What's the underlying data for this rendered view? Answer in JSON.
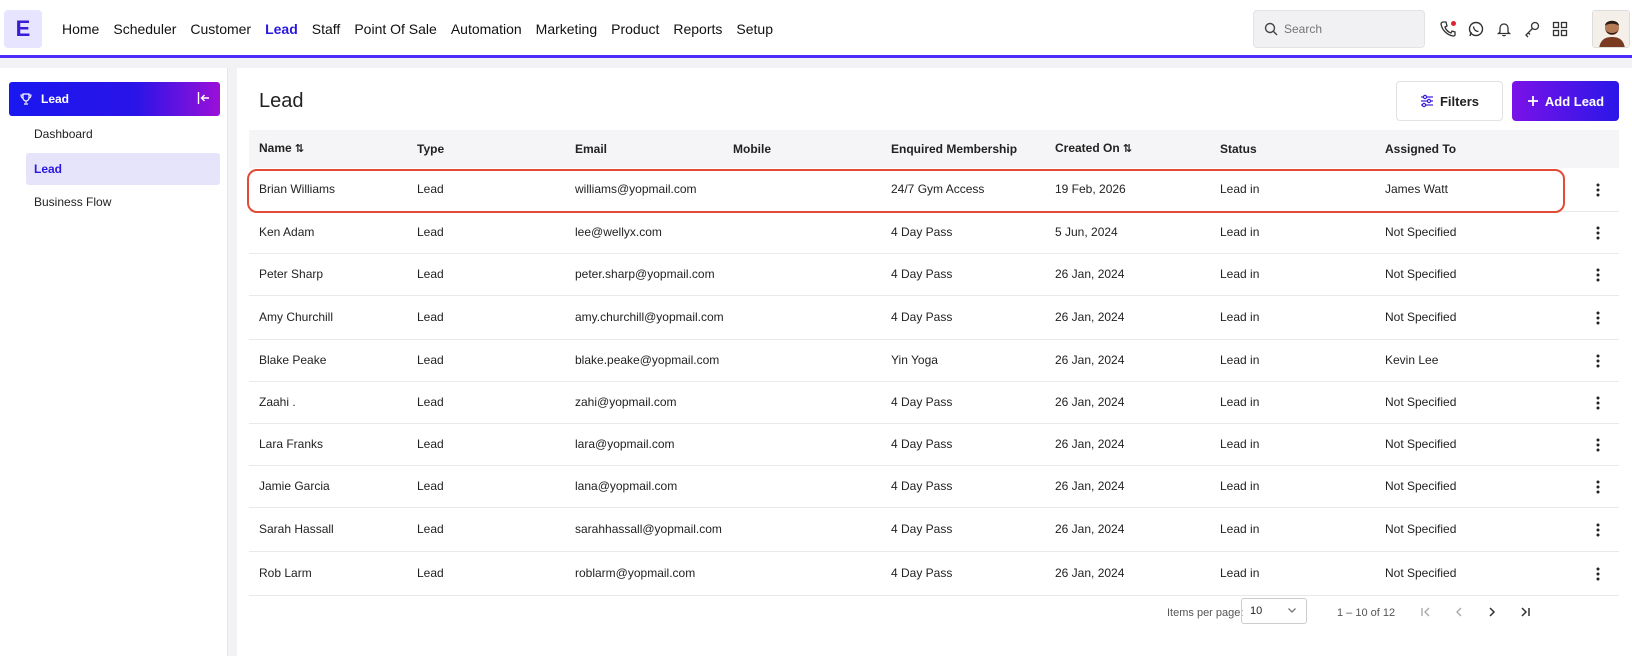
{
  "app": {
    "logo_letter": "E"
  },
  "nav": {
    "items": [
      {
        "label": "Home",
        "active": false
      },
      {
        "label": "Scheduler",
        "active": false
      },
      {
        "label": "Customer",
        "active": false
      },
      {
        "label": "Lead",
        "active": true
      },
      {
        "label": "Staff",
        "active": false
      },
      {
        "label": "Point Of Sale",
        "active": false
      },
      {
        "label": "Automation",
        "active": false
      },
      {
        "label": "Marketing",
        "active": false
      },
      {
        "label": "Product",
        "active": false
      },
      {
        "label": "Reports",
        "active": false
      },
      {
        "label": "Setup",
        "active": false
      }
    ],
    "search_placeholder": "Search",
    "icons": [
      "phone-icon",
      "whatsapp-icon",
      "bell-icon",
      "key-icon",
      "grid-icon"
    ]
  },
  "sidebar": {
    "title": "Lead",
    "items": [
      {
        "label": "Dashboard",
        "active": false
      },
      {
        "label": "Lead",
        "active": true
      },
      {
        "label": "Business Flow",
        "active": false
      }
    ]
  },
  "main": {
    "title": "Lead",
    "filters_label": "Filters",
    "add_label": "Add Lead"
  },
  "table": {
    "headers": [
      "Name",
      "Type",
      "Email",
      "Mobile",
      "Enquired Membership",
      "Created On",
      "Status",
      "Assigned To"
    ],
    "rows": [
      {
        "name": "Brian Williams",
        "type": "Lead",
        "email": "williams@yopmail.com",
        "mobile": "",
        "membership": "24/7 Gym Access",
        "created": "19 Feb, 2026",
        "status": "Lead in",
        "assigned": "James Watt",
        "highlighted": true
      },
      {
        "name": "Ken Adam",
        "type": "Lead",
        "email": "lee@wellyx.com",
        "mobile": "",
        "membership": "4 Day Pass",
        "created": "5 Jun, 2024",
        "status": "Lead in",
        "assigned": "Not Specified"
      },
      {
        "name": "Peter Sharp",
        "type": "Lead",
        "email": "peter.sharp@yopmail.com",
        "mobile": "",
        "membership": "4 Day Pass",
        "created": "26 Jan, 2024",
        "status": "Lead in",
        "assigned": "Not Specified"
      },
      {
        "name": "Amy Churchill",
        "type": "Lead",
        "email": "amy.churchill@yopmail.com",
        "mobile": "",
        "membership": "4 Day Pass",
        "created": "26 Jan, 2024",
        "status": "Lead in",
        "assigned": "Not Specified"
      },
      {
        "name": "Blake Peake",
        "type": "Lead",
        "email": "blake.peake@yopmail.com",
        "mobile": "",
        "membership": "Yin Yoga",
        "created": "26 Jan, 2024",
        "status": "Lead in",
        "assigned": "Kevin Lee"
      },
      {
        "name": "Zaahi .",
        "type": "Lead",
        "email": "zahi@yopmail.com",
        "mobile": "",
        "membership": "4 Day Pass",
        "created": "26 Jan, 2024",
        "status": "Lead in",
        "assigned": "Not Specified"
      },
      {
        "name": "Lara Franks",
        "type": "Lead",
        "email": "lara@yopmail.com",
        "mobile": "",
        "membership": "4 Day Pass",
        "created": "26 Jan, 2024",
        "status": "Lead in",
        "assigned": "Not Specified"
      },
      {
        "name": "Jamie Garcia",
        "type": "Lead",
        "email": "lana@yopmail.com",
        "mobile": "",
        "membership": "4 Day Pass",
        "created": "26 Jan, 2024",
        "status": "Lead in",
        "assigned": "Not Specified"
      },
      {
        "name": "Sarah Hassall",
        "type": "Lead",
        "email": "sarahhassall@yopmail.com",
        "mobile": "",
        "membership": "4 Day Pass",
        "created": "26 Jan, 2024",
        "status": "Lead in",
        "assigned": "Not Specified"
      },
      {
        "name": "Rob Larm",
        "type": "Lead",
        "email": "roblarm@yopmail.com",
        "mobile": "",
        "membership": "4 Day Pass",
        "created": "26 Jan, 2024",
        "status": "Lead in",
        "assigned": "Not Specified"
      }
    ]
  },
  "pagination": {
    "items_per_page_label": "Items per page:",
    "items_per_page": "10",
    "range": "1 – 10 of 12"
  },
  "colors": {
    "accent": "#2a17e0",
    "highlight_border": "#e24b36"
  }
}
